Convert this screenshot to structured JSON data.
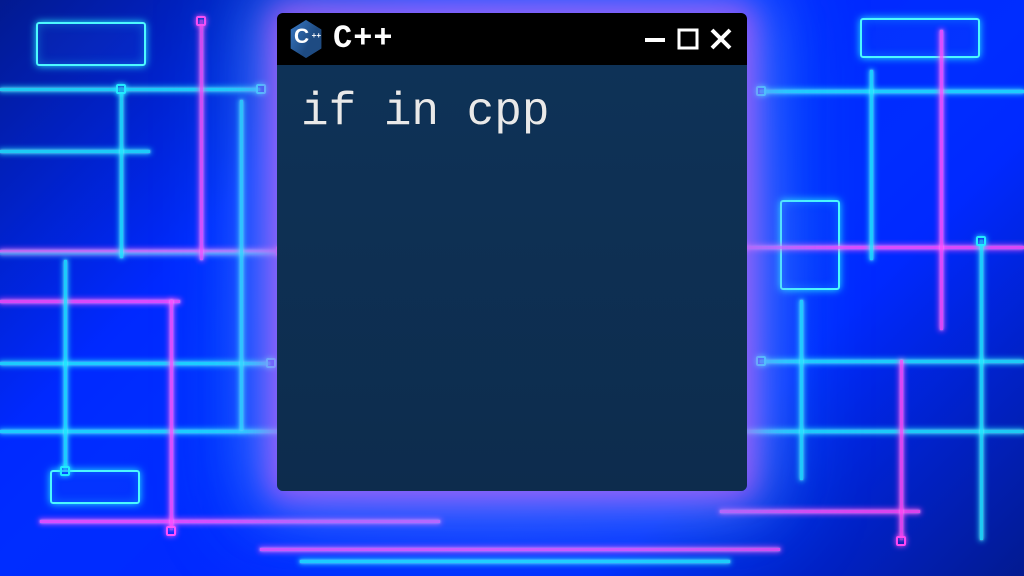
{
  "window": {
    "app_title": "C++",
    "logo_letter": "C",
    "logo_plus": "++"
  },
  "terminal": {
    "content": "if in cpp"
  }
}
